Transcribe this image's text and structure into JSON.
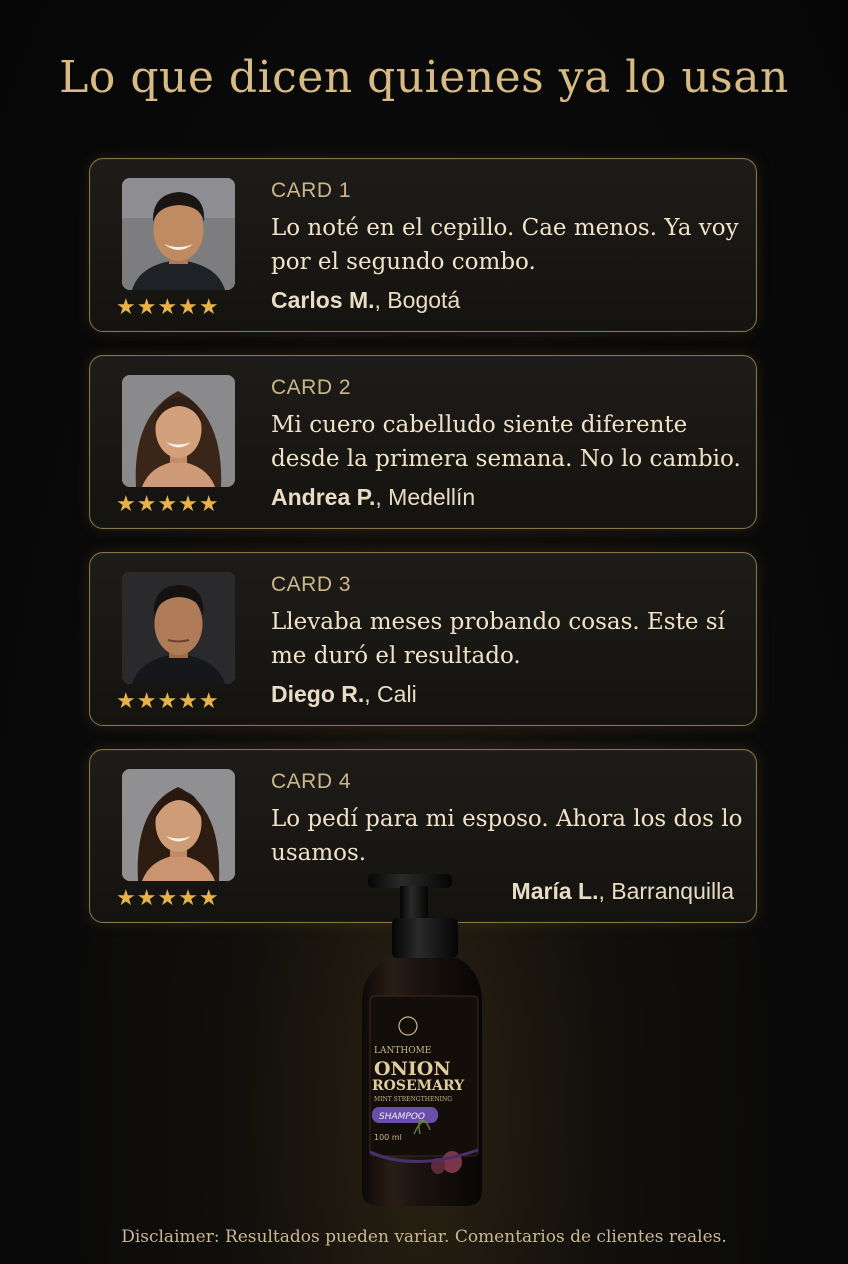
{
  "header": {
    "title": "Lo que dicen quienes ya lo usan"
  },
  "rating_icon": "star-icon",
  "accent_color": "#d8bb84",
  "star_color": "#e6b24a",
  "cards": [
    {
      "label": "CARD 1",
      "quote": "Lo noté en el cepillo. Cae menos. Ya voy por el segundo combo.",
      "author_name": "Carlos M.",
      "author_city": ", Bogotá",
      "rating": 5,
      "stars": "★★★★★"
    },
    {
      "label": "CARD 2",
      "quote": "Mi cuero cabelludo siente diferente desde la primera semana. No lo cambio.",
      "author_name": "Andrea P.",
      "author_city": ", Medellín",
      "rating": 5,
      "stars": "★★★★★"
    },
    {
      "label": "CARD 3",
      "quote": "Llevaba meses probando cosas. Este sí me duró el resultado.",
      "author_name": "Diego R.",
      "author_city": ", Cali",
      "rating": 5,
      "stars": "★★★★★"
    },
    {
      "label": "CARD 4",
      "quote": "Lo pedí para mi esposo. Ahora los dos lo usamos.",
      "author_name": "María L.",
      "author_city": ", Barranquilla",
      "rating": 5,
      "stars": "★★★★★"
    }
  ],
  "product": {
    "brand": "LANTHOME",
    "line1": "ONION",
    "line2": "ROSEMARY",
    "line3": "MINT STRENGTHENING",
    "type": "SHAMPOO",
    "volume": "100 ml"
  },
  "footer": {
    "disclaimer": "Disclaimer: Resultados pueden variar. Comentarios de clientes reales."
  }
}
